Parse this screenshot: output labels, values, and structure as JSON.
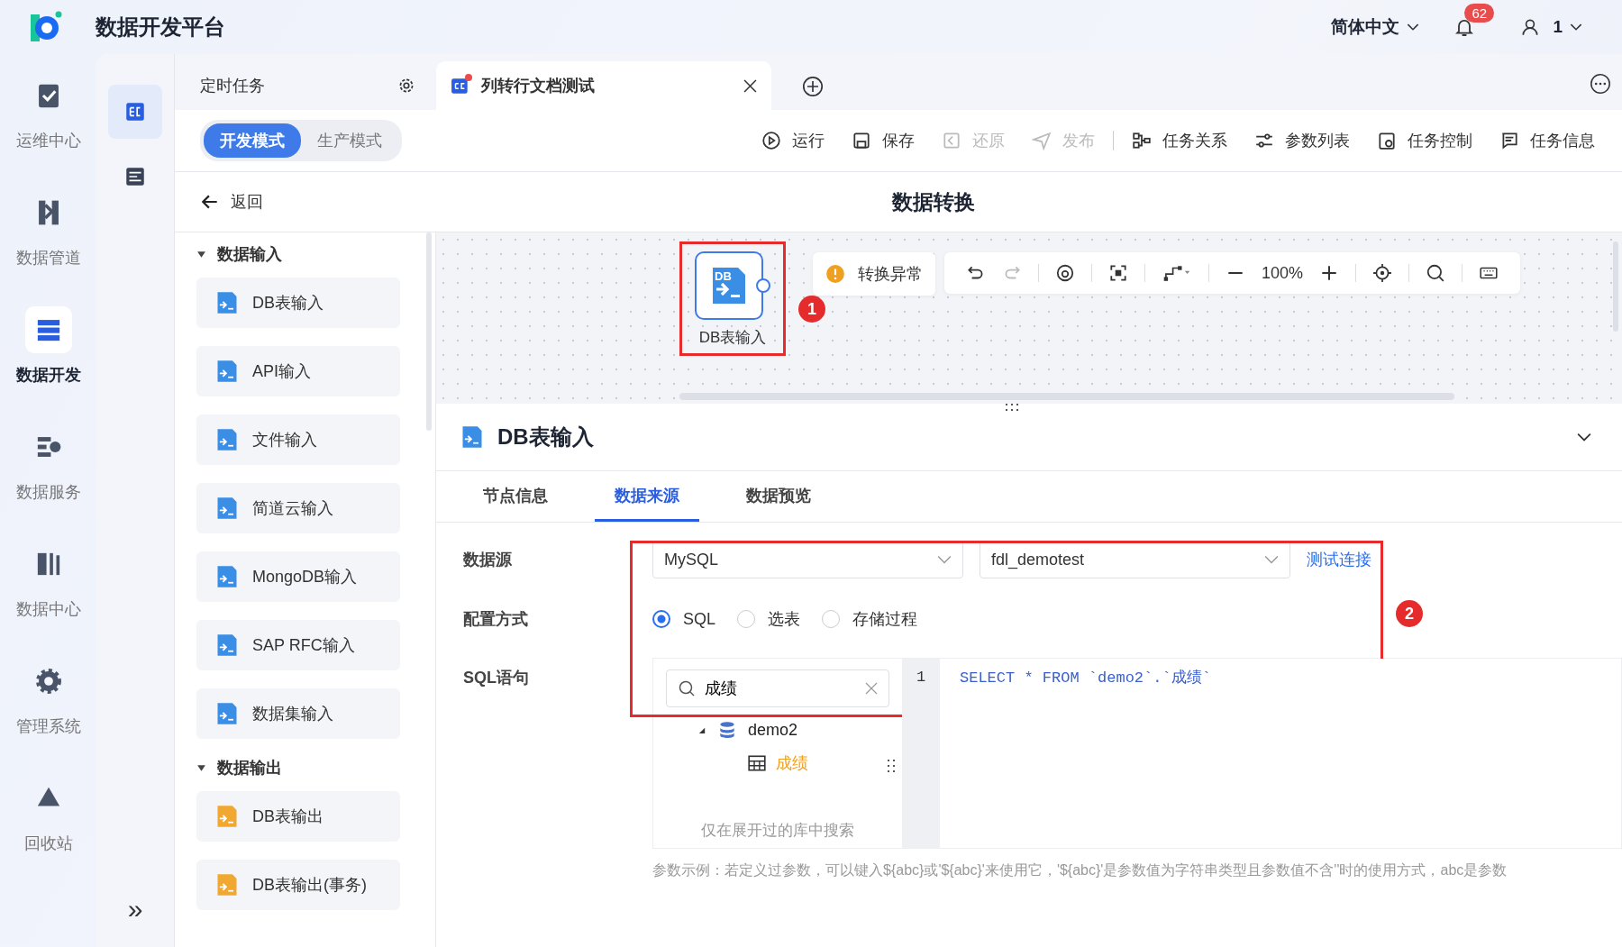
{
  "header": {
    "title": "数据开发平台",
    "language": "简体中文",
    "notification_count": "62",
    "user": "1"
  },
  "nav": [
    {
      "label": "运维中心",
      "selected": false
    },
    {
      "label": "数据管道",
      "selected": false
    },
    {
      "label": "数据开发",
      "selected": true
    },
    {
      "label": "数据服务",
      "selected": false
    },
    {
      "label": "数据中心",
      "selected": false
    },
    {
      "label": "管理系统",
      "selected": false
    },
    {
      "label": "回收站",
      "selected": false
    }
  ],
  "nav_expand": "»",
  "rail": [
    {
      "selected": true
    },
    {
      "selected": false
    }
  ],
  "tabs": [
    {
      "label": "定时任务",
      "selected": false,
      "closable": false
    },
    {
      "label": "列转行文档测试",
      "selected": true,
      "closable": true,
      "unsaved": true
    }
  ],
  "modes": [
    {
      "label": "开发模式",
      "selected": true
    },
    {
      "label": "生产模式",
      "selected": false
    }
  ],
  "actions": [
    {
      "label": "运行",
      "disabled": false
    },
    {
      "label": "保存",
      "disabled": false
    },
    {
      "label": "还原",
      "disabled": true
    },
    {
      "label": "发布",
      "disabled": true
    },
    {
      "label": "任务关系",
      "disabled": false,
      "separator_before": true
    },
    {
      "label": "参数列表",
      "disabled": false
    },
    {
      "label": "任务控制",
      "disabled": false
    },
    {
      "label": "任务信息",
      "disabled": false
    }
  ],
  "back": "返回",
  "page_title": "数据转换",
  "palette": [
    {
      "title": "数据输入",
      "expanded": true,
      "items": [
        {
          "label": "DB表输入",
          "color": "#3a8ee6"
        },
        {
          "label": "API输入",
          "color": "#3a8ee6"
        },
        {
          "label": "文件输入",
          "color": "#3a8ee6"
        },
        {
          "label": "简道云输入",
          "color": "#3a8ee6"
        },
        {
          "label": "MongoDB输入",
          "color": "#3a8ee6"
        },
        {
          "label": "SAP RFC输入",
          "color": "#3a8ee6"
        },
        {
          "label": "数据集输入",
          "color": "#3a8ee6"
        }
      ]
    },
    {
      "title": "数据输出",
      "expanded": true,
      "items": [
        {
          "label": "DB表输出",
          "color": "#f0a830"
        },
        {
          "label": "DB表输出(事务)",
          "color": "#f0a830"
        }
      ]
    }
  ],
  "canvas": {
    "node": {
      "label": "DB表输入",
      "badge": "DB",
      "callout": "1"
    },
    "warning": "转换异常",
    "zoom": "100%"
  },
  "panel": {
    "title": "DB表输入",
    "tabs": [
      {
        "label": "节点信息",
        "selected": false
      },
      {
        "label": "数据来源",
        "selected": true
      },
      {
        "label": "数据预览",
        "selected": false
      }
    ],
    "datasource_label": "数据源",
    "datasource_type": "MySQL",
    "datasource_name": "fdl_demotest",
    "test_link": "测试连接",
    "config_label": "配置方式",
    "config_options": [
      {
        "label": "SQL",
        "selected": true
      },
      {
        "label": "选表",
        "selected": false
      },
      {
        "label": "存储过程",
        "selected": false
      }
    ],
    "callout": "2",
    "sql_label": "SQL语句",
    "search_value": "成绩",
    "tree": [
      {
        "label": "demo2",
        "expanded": true,
        "children": [
          {
            "label": "成绩",
            "selected": true
          }
        ]
      }
    ],
    "tree_hint": "仅在展开过的库中搜索",
    "code_lines": [
      {
        "number": "1",
        "text": "SELECT * FROM `demo2`.`成绩`"
      }
    ],
    "param_hint": "参数示例：若定义过参数，可以键入${abc}或'${abc}'来使用它，'${abc}'是参数值为字符串类型且参数值不含''时的使用方式，abc是参数"
  }
}
